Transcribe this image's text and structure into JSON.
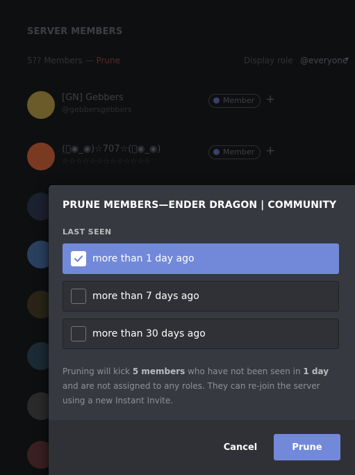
{
  "background": {
    "title": "SERVER MEMBERS",
    "member_count": "5?? Members —",
    "prune_link": "Prune",
    "display_role_label": "Display role",
    "role_filter": "@everyone",
    "members": [
      {
        "name": "[GN] Gebbers",
        "tag": "@gebbersgebbers",
        "role": "Member",
        "avatar_color": "#6b5a2a"
      },
      {
        "name": "(ﾟ◉_◉)☆707☆(ﾟ◉_◉)",
        "tag": "☆☆☆☆☆☆☆☆☆☆☆☆☆",
        "role": "Member",
        "avatar_color": "#7a3a22"
      }
    ],
    "avatar_colors": [
      "#1c2130",
      "#2a4060",
      "#2a2418",
      "#1b2a35",
      "#2a2a2a",
      "#3a2020"
    ]
  },
  "modal": {
    "title": "PRUNE MEMBERS—ENDER DRAGON | COMMUNITY",
    "section_label": "LAST SEEN",
    "options": [
      {
        "label": "more than 1 day ago",
        "selected": true
      },
      {
        "label": "more than 7 days ago",
        "selected": false
      },
      {
        "label": "more than 30 days ago",
        "selected": false
      }
    ],
    "description": {
      "part1": "Pruning will kick ",
      "count": "5 members",
      "part2": " who have not been seen in ",
      "period": "1 day",
      "part3": " and are not assigned to any roles. They can re-join the server using a new Instant Invite."
    },
    "cancel_label": "Cancel",
    "prune_label": "Prune"
  },
  "colors": {
    "accent": "#7289da",
    "modal_bg": "#36393f",
    "footer_bg": "#2f3136"
  }
}
